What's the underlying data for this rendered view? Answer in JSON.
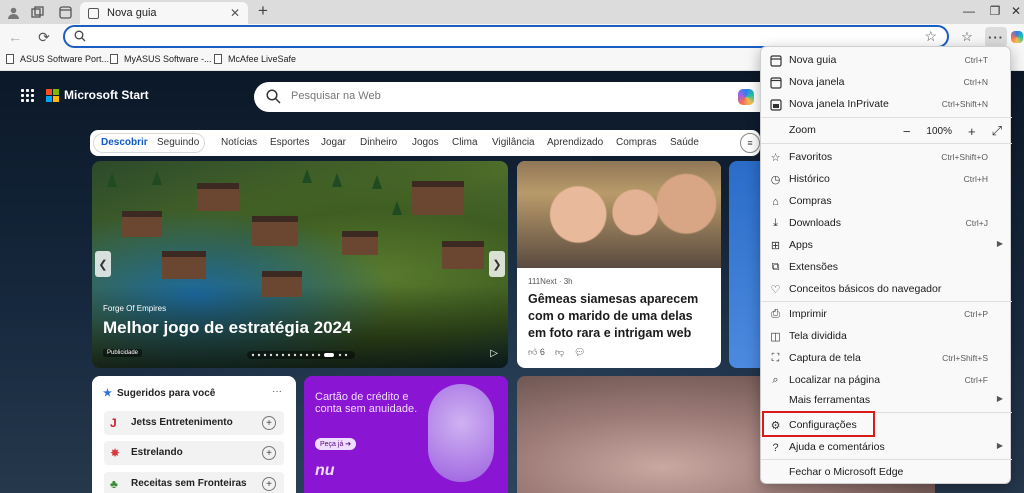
{
  "tab": {
    "title": "Nova guia"
  },
  "address_bar": {
    "value": "",
    "placeholder": ""
  },
  "favorites_bar": [
    {
      "label": "ASUS Software Port..."
    },
    {
      "label": "MyASUS Software -..."
    },
    {
      "label": "McAfee LiveSafe"
    }
  ],
  "page": {
    "brand": "Microsoft Start",
    "search_placeholder": "Pesquisar na Web",
    "nav": [
      "Descobrir",
      "Seguindo",
      "Notícias",
      "Esportes",
      "Jogar",
      "Dinheiro",
      "Jogos",
      "Clima",
      "Vigilância",
      "Aprendizado",
      "Compras",
      "Saúde"
    ],
    "hero": {
      "kicker": "Forge Of Empires",
      "headline": "Melhor jogo de estratégia 2024",
      "ad_label": "Publicidade"
    },
    "news_card": {
      "source": "111Next · 3h",
      "title": "Gêmeas siamesas aparecem com o marido de uma delas em foto rara e intrigam web",
      "likes": "6"
    },
    "suggested": {
      "header": "Sugeridos para você",
      "items": [
        "Jetss Entretenimento",
        "Estrelando",
        "Receitas sem Fronteiras"
      ]
    },
    "nu_ad": {
      "text": "Cartão de crédito e conta sem anuidade.",
      "cta": "Peça já ➔",
      "logo": "nu"
    }
  },
  "menu": {
    "items": [
      {
        "label": "Nova guia",
        "shortcut": "Ctrl+T",
        "icon": "new-tab-icon"
      },
      {
        "label": "Nova janela",
        "shortcut": "Ctrl+N",
        "icon": "new-window-icon"
      },
      {
        "label": "Nova janela InPrivate",
        "shortcut": "Ctrl+Shift+N",
        "icon": "inprivate-icon"
      },
      {
        "label": "Zoom",
        "zoom_value": "100%"
      },
      {
        "label": "Favoritos",
        "shortcut": "Ctrl+Shift+O",
        "icon": "favorites-icon"
      },
      {
        "label": "Histórico",
        "shortcut": "Ctrl+H",
        "icon": "history-icon"
      },
      {
        "label": "Compras",
        "shortcut": "",
        "icon": "shopping-icon"
      },
      {
        "label": "Downloads",
        "shortcut": "Ctrl+J",
        "icon": "download-icon"
      },
      {
        "label": "Apps",
        "shortcut": "",
        "icon": "apps-icon"
      },
      {
        "label": "Extensões",
        "shortcut": "",
        "icon": "extensions-icon"
      },
      {
        "label": "Conceitos básicos do navegador",
        "shortcut": "",
        "icon": "essentials-icon"
      },
      {
        "label": "Imprimir",
        "shortcut": "Ctrl+P",
        "icon": "print-icon"
      },
      {
        "label": "Tela dividida",
        "shortcut": "",
        "icon": "split-screen-icon"
      },
      {
        "label": "Captura de tela",
        "shortcut": "Ctrl+Shift+S",
        "icon": "screenshot-icon"
      },
      {
        "label": "Localizar na página",
        "shortcut": "Ctrl+F",
        "icon": "find-icon"
      },
      {
        "label": "Mais ferramentas",
        "shortcut": ""
      },
      {
        "label": "Configurações",
        "shortcut": "",
        "icon": "settings-icon"
      },
      {
        "label": "Ajuda e comentários",
        "shortcut": "",
        "icon": "help-icon"
      },
      {
        "label": "Fechar o Microsoft Edge",
        "shortcut": ""
      }
    ]
  },
  "colors": {
    "accent": "#1a5ec4",
    "highlight": "#d81c1c",
    "nu_purple": "#8a16d4"
  }
}
